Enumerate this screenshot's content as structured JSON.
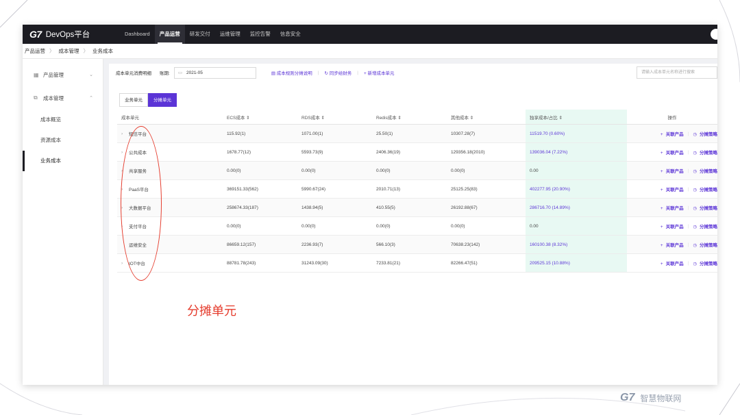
{
  "app": {
    "logo": "G7",
    "title": "DevOps平台"
  },
  "nav": [
    "Dashboard",
    "产品运营",
    "研发交付",
    "运维管理",
    "监控告警",
    "信息安全"
  ],
  "breadcrumb": [
    "产品运营",
    "成本管理",
    "业务成本"
  ],
  "sidebar": {
    "groups": [
      {
        "label": "产品管理",
        "icon": "grid-icon"
      },
      {
        "label": "成本管理",
        "icon": "copy-icon"
      }
    ],
    "items": [
      "成本概览",
      "资源成本",
      "业务成本"
    ],
    "active": "业务成本"
  },
  "toolbar": {
    "title": "成本单元消费明细",
    "period_label": "账期:",
    "period_value": "2021-05",
    "link1": "成本规则分摊说明",
    "link2": "同步给财务",
    "link3": "+ 新增成本单元",
    "search_placeholder": "请输入成本单元名称进行搜索"
  },
  "tabs": [
    "业务单元",
    "分摊单元"
  ],
  "table": {
    "headers": [
      "成本单元",
      "ECS成本 ⇕",
      "RDS成本 ⇕",
      "Redis成本 ⇕",
      "其他成本 ⇕",
      "独享成本/占比 ⇕",
      "操作"
    ],
    "rows": [
      [
        "短信平台",
        "115.92(1)",
        "1071.00(1)",
        "25.50(1)",
        "10307.28(7)",
        "11519.70 (0.60%)"
      ],
      [
        "公共成本",
        "1678.77(12)",
        "5593.73(9)",
        "2406.36(19)",
        "129356.18(2010)",
        "139036.04 (7.22%)"
      ],
      [
        "共享服务",
        "0.00(0)",
        "0.00(0)",
        "0.00(0)",
        "0.00(0)",
        "0.00"
      ],
      [
        "PaaS平台",
        "369151.33(562)",
        "5990.67(24)",
        "2010.71(13)",
        "25125.25(83)",
        "402277.95 (20.90%)"
      ],
      [
        "大数据平台",
        "258674.33(187)",
        "1438.94(5)",
        "410.55(5)",
        "26192.88(67)",
        "286716.70 (14.89%)"
      ],
      [
        "支付平台",
        "0.00(0)",
        "0.00(0)",
        "0.00(0)",
        "0.00(0)",
        "0.00"
      ],
      [
        "运维安全",
        "86659.12(157)",
        "2236.93(7)",
        "566.10(3)",
        "70638.23(142)",
        "160100.38 (8.32%)"
      ],
      [
        "IOT中台",
        "88781.78(243)",
        "31243.09(30)",
        "7233.81(21)",
        "82266.47(51)",
        "209525.15 (10.88%)"
      ]
    ],
    "action1": "关联产品",
    "action2": "分摊策略"
  },
  "annotation": "分摊单元",
  "watermark": {
    "mark": "G7",
    "text": "智慧物联网"
  },
  "colors": {
    "accent": "#5b34d6",
    "annotation": "#e53b2c",
    "highlight_col": "#e8f9f3",
    "topbar": "#1c1c22"
  }
}
